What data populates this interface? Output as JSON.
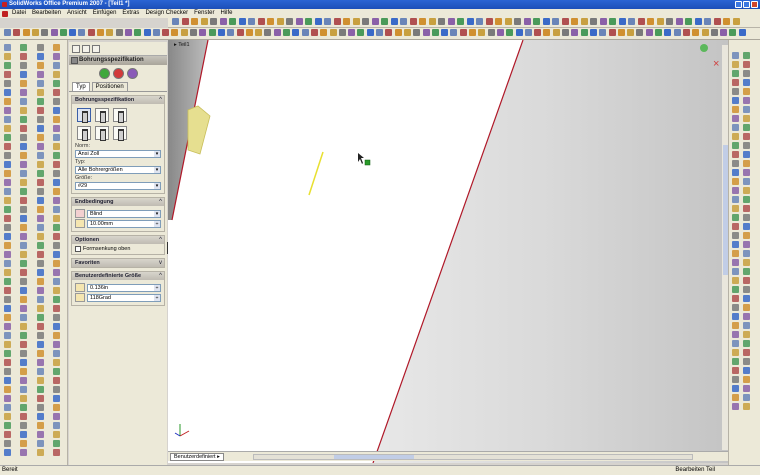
{
  "window": {
    "title": "SolidWorks Office Premium 2007 - [Teil1 *]"
  },
  "menu": [
    "Datei",
    "Bearbeiten",
    "Ansicht",
    "Einfügen",
    "Extras",
    "Design Checker",
    "Fenster",
    "Hilfe"
  ],
  "graphics": {
    "tree_label": "Teil1",
    "tab_label": "Benutzerdefiniert"
  },
  "property_manager": {
    "title": "Bohrungsspezifikation",
    "tabs": [
      "Typ",
      "Positionen"
    ],
    "group_spec": {
      "title": "Bohrungsspezifikation",
      "norm_label": "Norm:",
      "norm_value": "Ansi Zoll",
      "type_label": "Typ:",
      "type_value": "Alle Bohrergrößen",
      "size_label": "Größe:",
      "size_value": "#29"
    },
    "group_end": {
      "title": "Endbedingung",
      "condition": "Blind",
      "depth": "10.00mm"
    },
    "group_options": {
      "title": "Optionen",
      "checkbox": "Formsenkung oben"
    },
    "group_favorites": {
      "title": "Favoriten"
    },
    "group_custom": {
      "title": "Benutzerdefinierte Größe",
      "diameter": "0.136in",
      "angle": "118Grad"
    }
  },
  "status": {
    "left": "Bereit",
    "right": "Bearbeiten Teil"
  },
  "colors": {
    "edge_red": "#b01828",
    "sketch_yellow": "#e8e030",
    "title_blue": "#2a64d4"
  }
}
